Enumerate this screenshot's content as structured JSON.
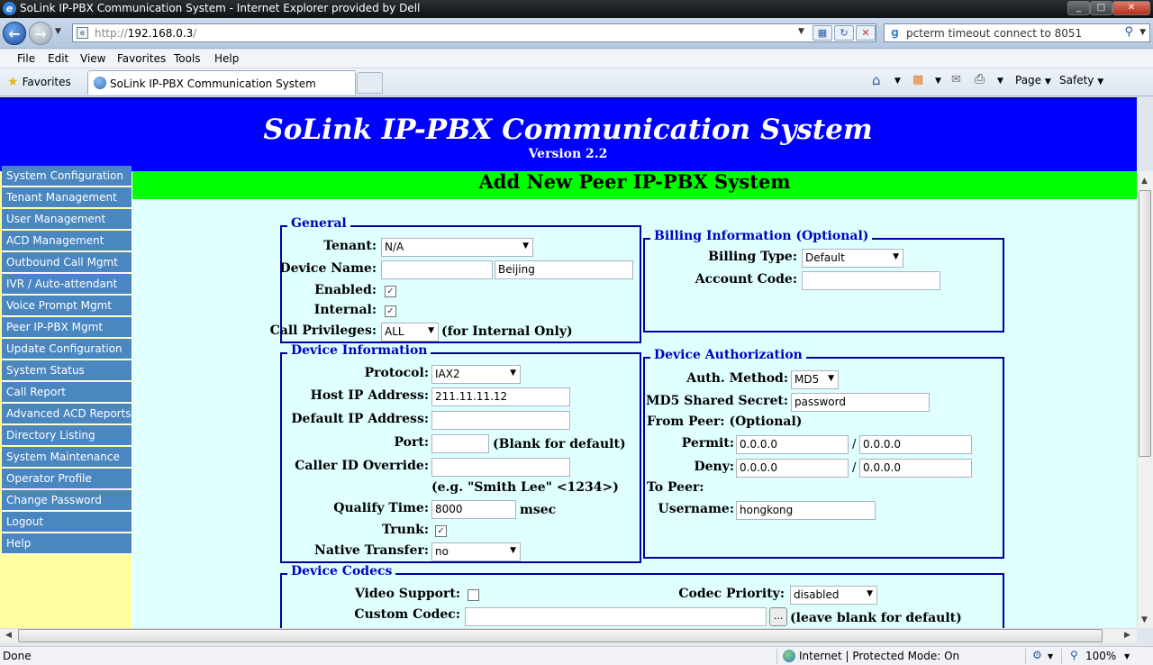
{
  "window": {
    "title": "SoLink IP-PBX Communication System - Internet Explorer provided by Dell",
    "controls": [
      "_",
      "□",
      "✕"
    ]
  },
  "address_bar": {
    "url_prefix": "http://",
    "url_host": "192.168.0.3",
    "url_suffix": "/"
  },
  "search_bar": {
    "value": "pcterm timeout connect to 8051"
  },
  "menu": {
    "file": "File",
    "edit": "Edit",
    "view": "View",
    "favorites": "Favorites",
    "tools": "Tools",
    "help": "Help"
  },
  "favorites_bar": {
    "favorites_label": "Favorites",
    "tab_title": "SoLink IP-PBX Communication System",
    "page_label": "Page",
    "safety_label": "Safety"
  },
  "header": {
    "title": "SoLink IP-PBX Communication System",
    "version": "Version 2.2"
  },
  "sidebar": {
    "items": [
      "System Configuration",
      "Tenant Management",
      "User Management",
      "ACD Management",
      "Outbound Call Mgmt",
      "IVR / Auto-attendant",
      "Voice Prompt Mgmt",
      "Peer IP-PBX Mgmt",
      "Update Configuration",
      "System Status",
      "Call Report",
      "Advanced ACD Reports",
      "Directory Listing",
      "System Maintenance",
      "Operator Profile",
      "Change Password",
      "Logout",
      "Help"
    ]
  },
  "page_title": "Add New Peer IP-PBX System",
  "general": {
    "legend": "General",
    "tenant_label": "Tenant:",
    "tenant_value": "N/A",
    "device_name_label": "Device Name:",
    "device_name_value1": "",
    "device_name_value2": "Beijing",
    "enabled_label": "Enabled:",
    "enabled_checked": "✓",
    "internal_label": "Internal:",
    "internal_checked": "✓",
    "call_privileges_label": "Call Privileges:",
    "call_privileges_value": "ALL",
    "call_privileges_note": "(for Internal Only)"
  },
  "billing": {
    "legend": "Billing Information (Optional)",
    "billing_type_label": "Billing Type:",
    "billing_type_value": "Default",
    "account_code_label": "Account Code:",
    "account_code_value": ""
  },
  "device_info": {
    "legend": "Device Information",
    "protocol_label": "Protocol:",
    "protocol_value": "IAX2",
    "host_ip_label": "Host IP Address:",
    "host_ip_value": "211.11.11.12",
    "default_ip_label": "Default IP Address:",
    "default_ip_value": "",
    "port_label": "Port:",
    "port_value": "",
    "port_note": "(Blank for default)",
    "caller_id_label": "Caller ID Override:",
    "caller_id_value": "",
    "caller_id_example": "(e.g. \"Smith Lee\" <1234>)",
    "qualify_label": "Qualify Time:",
    "qualify_value": "8000",
    "qualify_unit": "msec",
    "trunk_label": "Trunk:",
    "trunk_checked": "✓",
    "native_transfer_label": "Native Transfer:",
    "native_transfer_value": "no"
  },
  "auth": {
    "legend": "Device Authorization",
    "method_label": "Auth. Method:",
    "method_value": "MD5",
    "secret_label": "MD5 Shared Secret:",
    "secret_value": "password",
    "from_peer_label": "From Peer: (Optional)",
    "permit_label": "Permit:",
    "permit_ip": "0.0.0.0",
    "permit_mask": "0.0.0.0",
    "deny_label": "Deny:",
    "deny_ip": "0.0.0.0",
    "deny_mask": "0.0.0.0",
    "slash": "/",
    "to_peer_label": "To Peer:",
    "username_label": "Username:",
    "username_value": "hongkong"
  },
  "codecs": {
    "legend": "Device Codecs",
    "video_label": "Video Support:",
    "video_checked": "",
    "priority_label": "Codec Priority:",
    "priority_value": "disabled",
    "custom_label": "Custom Codec:",
    "custom_value": "",
    "custom_button": "...",
    "custom_note": "(leave blank for default)"
  },
  "status_bar": {
    "status": "Done",
    "zone": "Internet | Protected Mode: On",
    "zoom": "100%"
  }
}
